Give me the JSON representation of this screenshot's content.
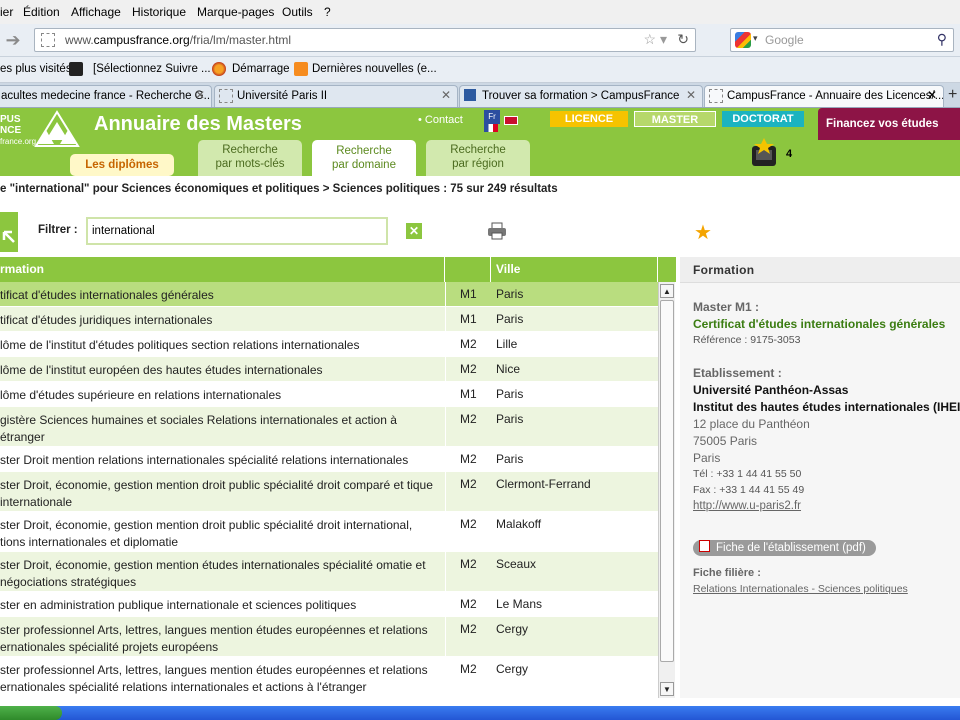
{
  "menubar": [
    "ier",
    "Édition",
    "Affichage",
    "Historique",
    "Marque-pages",
    "Outils",
    "?"
  ],
  "navbar": {
    "url_prefix": "www.",
    "url_host": "campusfrance.org",
    "url_path": "/fria/lm/master.html",
    "search_placeholder": "Google"
  },
  "bookmarks": [
    {
      "label": "es plus visités",
      "icon": "none"
    },
    {
      "label": "[Sélectionnez Suivre ...",
      "icon": "cned-icon"
    },
    {
      "label": "Démarrage",
      "icon": "firefox-icon"
    },
    {
      "label": "Dernières nouvelles (e...",
      "icon": "rss-icon"
    }
  ],
  "tabs": [
    {
      "label": "acultes medecine france - Recherche G...",
      "active": false
    },
    {
      "label": "Université Paris II",
      "active": false
    },
    {
      "label": "Trouver sa formation > CampusFrance",
      "active": false
    },
    {
      "label": "CampusFrance - Annuaire des Licences/...",
      "active": true
    }
  ],
  "site": {
    "logo_line1": "PUS",
    "logo_line2": "NCE",
    "logo_line3": "france.org",
    "title": "Annuaire des Masters",
    "contact": "• Contact",
    "flag_text": "Fr",
    "btn_licence": "LICENCE",
    "btn_master": "MASTER",
    "btn_doctorat": "DOCTORAT",
    "financez": "Financez vos études",
    "tab_diplomes": "Les diplômes",
    "tab_motscles_1": "Recherche",
    "tab_motscles_2": "par mots-clés",
    "tab_domaine_1": "Recherche",
    "tab_domaine_2": "par domaine",
    "tab_region_1": "Recherche",
    "tab_region_2": "par région",
    "panier_count": "4"
  },
  "breadcrumb": "e \"international\" pour Sciences économiques et politiques > Sciences politiques : 75 sur 249 résultats",
  "filter": {
    "label": "Filtrer :",
    "value": "international",
    "clear": "✕"
  },
  "table": {
    "col_formation": "rmation",
    "col_ville": "Ville",
    "rows": [
      {
        "formation": "tificat d'études internationales générales",
        "niveau": "M1",
        "ville": "Paris"
      },
      {
        "formation": "tificat d'études juridiques internationales",
        "niveau": "M1",
        "ville": "Paris"
      },
      {
        "formation": "lôme de l'institut d'études politiques section relations internationales",
        "niveau": "M2",
        "ville": "Lille"
      },
      {
        "formation": "lôme de l'institut européen des hautes études internationales",
        "niveau": "M2",
        "ville": "Nice"
      },
      {
        "formation": "lôme d'études supérieure en relations internationales",
        "niveau": "M1",
        "ville": "Paris"
      },
      {
        "formation": "gistère Sciences humaines et sociales Relations internationales et action à étranger",
        "niveau": "M2",
        "ville": "Paris"
      },
      {
        "formation": "ster Droit mention relations internationales spécialité relations internationales",
        "niveau": "M2",
        "ville": "Paris"
      },
      {
        "formation": "ster Droit, économie, gestion mention droit public spécialité droit comparé et tique internationale",
        "niveau": "M2",
        "ville": "Clermont-Ferrand"
      },
      {
        "formation": "ster Droit, économie, gestion mention droit public spécialité droit international, tions internationales et diplomatie",
        "niveau": "M2",
        "ville": "Malakoff"
      },
      {
        "formation": "ster Droit, économie, gestion mention études internationales spécialité omatie et négociations stratégiques",
        "niveau": "M2",
        "ville": "Sceaux"
      },
      {
        "formation": "ster en administration publique internationale et sciences politiques",
        "niveau": "M2",
        "ville": "Le Mans"
      },
      {
        "formation": "ster professionnel Arts, lettres, langues mention études européennes et relations ernationales spécialité projets européens",
        "niveau": "M2",
        "ville": "Cergy"
      },
      {
        "formation": "ster professionnel Arts, lettres, langues mention études européennes et relations ernationales spécialité relations internationales et actions à l'étranger",
        "niveau": "M2",
        "ville": "Cergy"
      }
    ]
  },
  "detail": {
    "header": "Formation",
    "level_label": "Master M1 :",
    "title": "Certificat d'études internationales générales",
    "reference": "Référence : 9175-3053",
    "etab_label": "Etablissement :",
    "univ": "Université Panthéon-Assas",
    "institut": "Institut des hautes études internationales (IHEI)",
    "addr1": "12 place du Panthéon",
    "addr2": "75005 Paris",
    "addr3": "Paris",
    "tel": "Tél : +33 1 44 41 55 50",
    "fax": "Fax : +33 1 44 41 55 49",
    "web": "http://www.u-paris2.fr",
    "pdf": "Fiche de l'établissement (pdf)",
    "fiche_label": "Fiche filière :",
    "fiche_link": "Relations Internationales - Sciences politiques"
  },
  "colors": {
    "green": "#8cc63f",
    "row_selected": "#b9dd7f",
    "row_alt": "#edf5df",
    "darkgreen": "#3b7d12"
  }
}
